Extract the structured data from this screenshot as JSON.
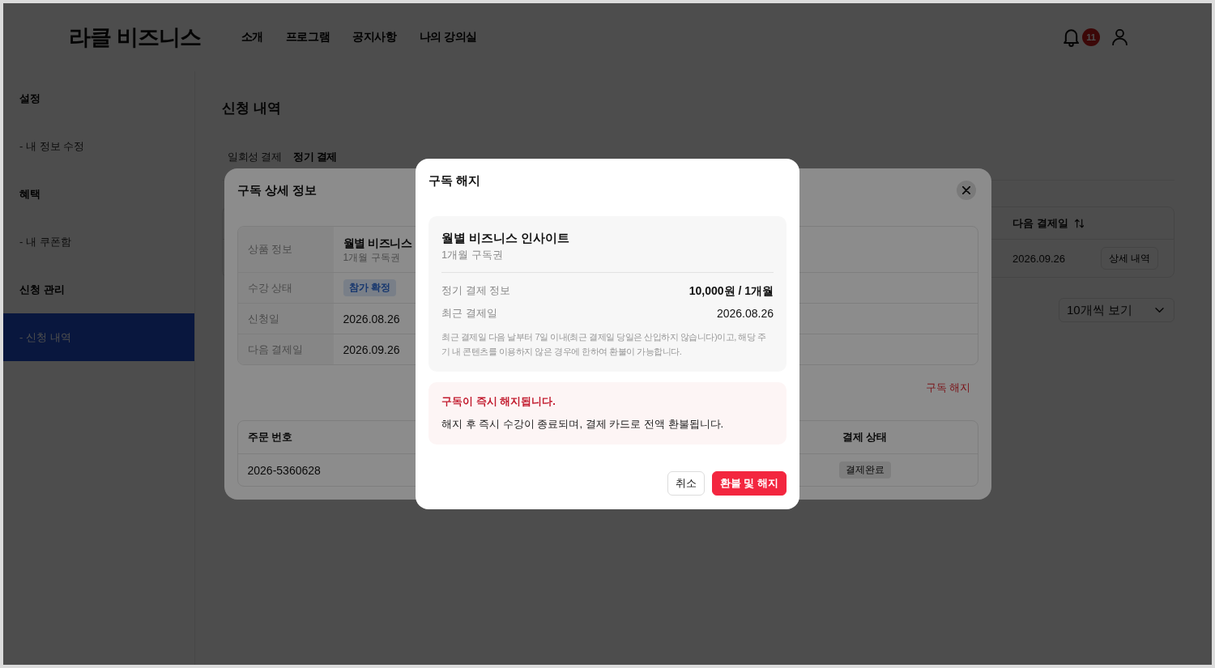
{
  "header": {
    "logo": "라클 비즈니스",
    "nav": [
      {
        "label": "소개"
      },
      {
        "label": "프로그램"
      },
      {
        "label": "공지사항"
      },
      {
        "label": "나의 강의실"
      }
    ],
    "notification_count": "11"
  },
  "sidebar": {
    "sections": [
      {
        "title": "설정",
        "items": [
          {
            "label": "- 내 정보 수정",
            "selected": false
          }
        ]
      },
      {
        "title": "혜택",
        "items": [
          {
            "label": "- 내 쿠폰함",
            "selected": false
          }
        ]
      },
      {
        "title": "신청 관리",
        "items": [
          {
            "label": "- 신청 내역",
            "selected": true
          }
        ]
      }
    ]
  },
  "main": {
    "title": "신청 내역",
    "tabs": [
      {
        "label": "일회성 결제",
        "selected": false
      },
      {
        "label": "정기 결제",
        "selected": true
      }
    ],
    "table": {
      "columns": [
        "다음 결제일"
      ],
      "rows": [
        {
          "next_payment": "2026.09.26",
          "action": "상세 내역"
        }
      ]
    },
    "page_size": "10개씩 보기"
  },
  "detail_modal": {
    "title": "구독 상세 정보",
    "info": [
      {
        "kind": "product",
        "label": "상품 정보",
        "value": "월별 비즈니스",
        "sub": "1개월 구독권"
      },
      {
        "kind": "badge",
        "label": "수강 상태",
        "value": "참가 확정"
      },
      {
        "kind": "text",
        "label": "신청일",
        "value": "2026.08.26"
      },
      {
        "kind": "text",
        "label": "다음 결제일",
        "value": "2026.09.26"
      }
    ],
    "cancel_link": "구독 해지",
    "orders": {
      "columns": [
        "주문 번호",
        "결제 상태"
      ],
      "rows": [
        {
          "order_number": "2026-5360628",
          "payment_status": "결제완료"
        }
      ]
    }
  },
  "cancel_modal": {
    "title": "구독 해지",
    "product": {
      "name": "월별 비즈니스 인사이트",
      "plan": "1개월 구독권"
    },
    "details": [
      {
        "label": "정기 결제 정보",
        "value": "10,000원 / 1개월",
        "emphasized": true
      },
      {
        "label": "최근 결제일",
        "value": "2026.08.26",
        "emphasized": false
      }
    ],
    "note": "최근 결제일 다음 날부터 7일 이내(최근 결제일 당일은 산입하지 않습니다)이고, 해당 주기 내 콘텐츠를 이용하지 않은 경우에 한하여 환불이 가능합니다.",
    "warning": {
      "title": "구독이 즉시 해지됩니다.",
      "message": "해지 후 즉시 수강이 종료되며, 결제 카드로 전액 환불됩니다."
    },
    "buttons": [
      {
        "label": "취소",
        "kind": "secondary"
      },
      {
        "label": "환불 및 해지",
        "kind": "danger"
      }
    ]
  }
}
